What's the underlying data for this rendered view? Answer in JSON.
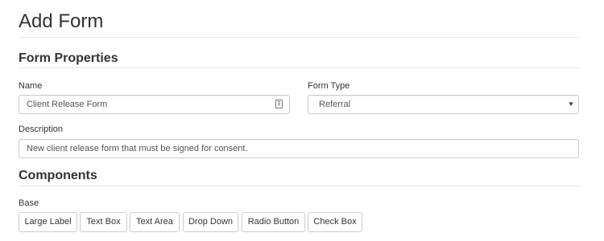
{
  "page": {
    "title": "Add Form"
  },
  "form_properties": {
    "section_title": "Form Properties",
    "name_label": "Name",
    "name_value": "Client Release Form",
    "form_type_label": "Form Type",
    "form_type_value": "Referral",
    "description_label": "Description",
    "description_value": "New client release form that must be signed for consent."
  },
  "components": {
    "section_title": "Components",
    "group_label": "Base",
    "buttons": [
      "Large Label",
      "Text Box",
      "Text Area",
      "Drop Down",
      "Radio Button",
      "Check Box"
    ]
  },
  "icons": {
    "name_field_icon": "contact-card-icon",
    "form_type_caret": "caret-down-icon"
  },
  "colors": {
    "border": "#cccccc",
    "text": "#333333",
    "divider": "#e8e8e8"
  }
}
